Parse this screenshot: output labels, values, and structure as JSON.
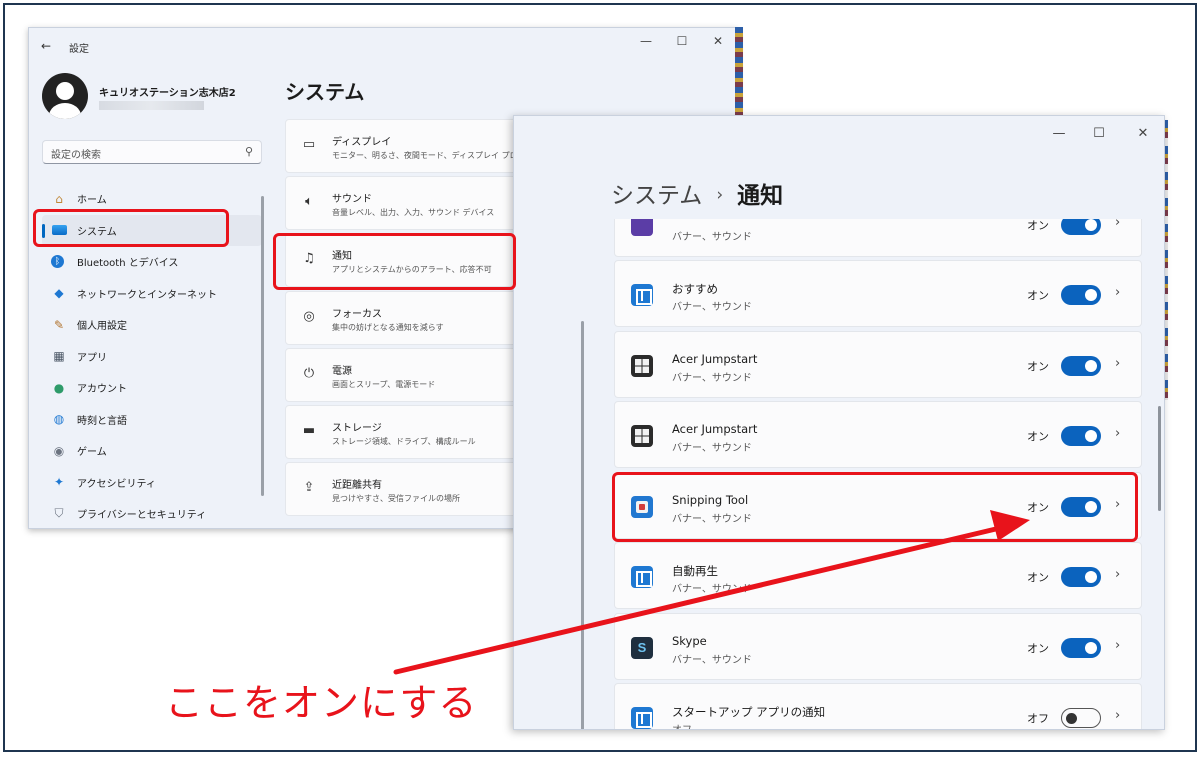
{
  "back_window": {
    "title": "設定",
    "user_name": "キュリオステーション志木店2",
    "search_placeholder": "設定の検索",
    "nav": [
      {
        "label": "ホーム",
        "icon": "home-icon"
      },
      {
        "label": "システム",
        "icon": "system-icon",
        "active": true
      },
      {
        "label": "Bluetooth とデバイス",
        "icon": "bluetooth-icon"
      },
      {
        "label": "ネットワークとインターネット",
        "icon": "wifi-icon"
      },
      {
        "label": "個人用設定",
        "icon": "brush-icon"
      },
      {
        "label": "アプリ",
        "icon": "apps-icon"
      },
      {
        "label": "アカウント",
        "icon": "account-icon"
      },
      {
        "label": "時刻と言語",
        "icon": "globe-icon"
      },
      {
        "label": "ゲーム",
        "icon": "gamepad-icon"
      },
      {
        "label": "アクセシビリティ",
        "icon": "accessibility-icon"
      },
      {
        "label": "プライバシーとセキュリティ",
        "icon": "shield-icon"
      }
    ],
    "page_title": "システム",
    "background_fragment": "店2",
    "items": [
      {
        "title": "ディスプレイ",
        "sub": "モニター、明るさ、夜間モード、ディスプレイ プロファイ",
        "icon": "display-icon"
      },
      {
        "title": "サウンド",
        "sub": "音量レベル、出力、入力、サウンド デバイス",
        "icon": "sound-icon"
      },
      {
        "title": "通知",
        "sub": "アプリとシステムからのアラート、応答不可",
        "icon": "bell-icon"
      },
      {
        "title": "フォーカス",
        "sub": "集中の妨げとなる通知を減らす",
        "icon": "focus-icon"
      },
      {
        "title": "電源",
        "sub": "画面とスリープ、電源モード",
        "icon": "power-icon"
      },
      {
        "title": "ストレージ",
        "sub": "ストレージ領域、ドライブ、構成ルール",
        "icon": "storage-icon"
      },
      {
        "title": "近距離共有",
        "sub": "見つけやすさ、受信ファイルの場所",
        "icon": "share-icon"
      }
    ]
  },
  "front_window": {
    "breadcrumb_parent": "システム",
    "breadcrumb_separator": "›",
    "breadcrumb_current": "通知",
    "apps": [
      {
        "name": "",
        "sub": "バナー、サウンド",
        "state": "オン",
        "on": true,
        "icon": "app-purple-icon"
      },
      {
        "name": "おすすめ",
        "sub": "バナー、サウンド",
        "state": "オン",
        "on": true,
        "icon": "app-blue-icon"
      },
      {
        "name": "Acer Jumpstart",
        "sub": "バナー、サウンド",
        "state": "オン",
        "on": true,
        "icon": "app-grid-icon"
      },
      {
        "name": "Acer Jumpstart",
        "sub": "バナー、サウンド",
        "state": "オン",
        "on": true,
        "icon": "app-grid-icon"
      },
      {
        "name": "Snipping Tool",
        "sub": "バナー、サウンド",
        "state": "オン",
        "on": true,
        "icon": "snipping-tool-icon"
      },
      {
        "name": "自動再生",
        "sub": "バナー、サウンド",
        "state": "オン",
        "on": true,
        "icon": "app-blue-icon"
      },
      {
        "name": "Skype",
        "sub": "バナー、サウンド",
        "state": "オン",
        "on": true,
        "icon": "skype-icon"
      },
      {
        "name": "スタートアップ アプリの通知",
        "sub": "オフ",
        "state": "オフ",
        "on": false,
        "icon": "app-blue-icon"
      }
    ]
  },
  "annotation": {
    "callout": "ここをオンにする",
    "color": "#e8131b"
  },
  "window_controls": {
    "minimize": "—",
    "maximize": "☐",
    "close": "✕"
  }
}
